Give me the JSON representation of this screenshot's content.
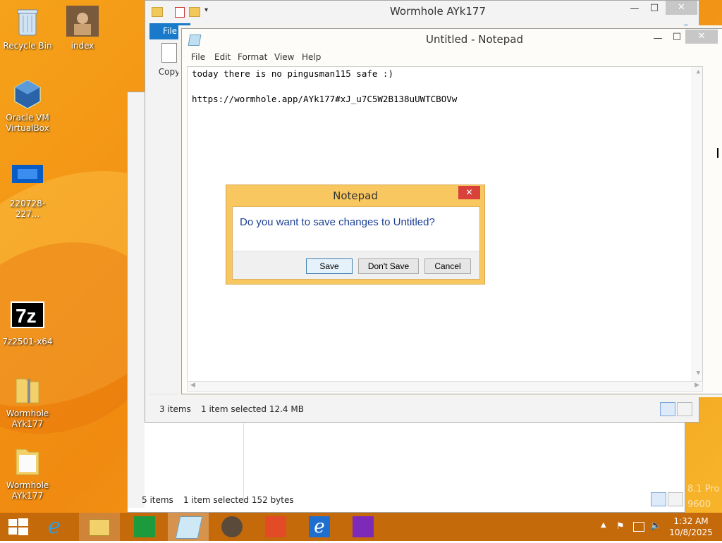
{
  "desktop": {
    "icons": [
      {
        "label": "Recycle Bin"
      },
      {
        "label": "index"
      },
      {
        "label": "Oracle VM VirtualBox"
      },
      {
        "label": "220728-227..."
      },
      {
        "label": "7z2501-x64"
      },
      {
        "label": "Wormhole AYk177"
      },
      {
        "label": "Wormhole AYk177"
      }
    ]
  },
  "explorer_front": {
    "title": "Wormhole AYk177",
    "file_tab": "File",
    "copy_label": "Copy",
    "status_items": "3 items",
    "status_selected": "1 item selected  12.4 MB"
  },
  "explorer_back": {
    "status_items": "5 items",
    "status_selected": "1 item selected  152 bytes"
  },
  "notepad": {
    "title": "Untitled - Notepad",
    "menu": [
      "File",
      "Edit",
      "Format",
      "View",
      "Help"
    ],
    "lines": [
      "today there is no pingusman115 safe :)",
      "",
      "https://wormhole.app/AYk177#xJ_u7C5W2B138uUWTCBOVw"
    ]
  },
  "dialog": {
    "title": "Notepad",
    "message": "Do you want to save changes to Untitled?",
    "save": "Save",
    "dont_save": "Don't Save",
    "cancel": "Cancel"
  },
  "taskbar": {
    "time": "1:32 AM",
    "date": "10/8/2025",
    "watermark_line1": "8.1 Pro",
    "watermark_line2": "9600",
    "apps": [
      "start-icon",
      "internet-explorer-icon",
      "file-explorer-icon",
      "store-icon",
      "notepad-icon",
      "raccoon-app-icon",
      "people-icon",
      "internet-explorer-icon-2",
      "search-app-icon"
    ]
  },
  "colors": {
    "desktop": "#f49b17",
    "taskbar": "#c56a0b",
    "accent_blue": "#1979ca",
    "dialog_text": "#1c3f94"
  }
}
